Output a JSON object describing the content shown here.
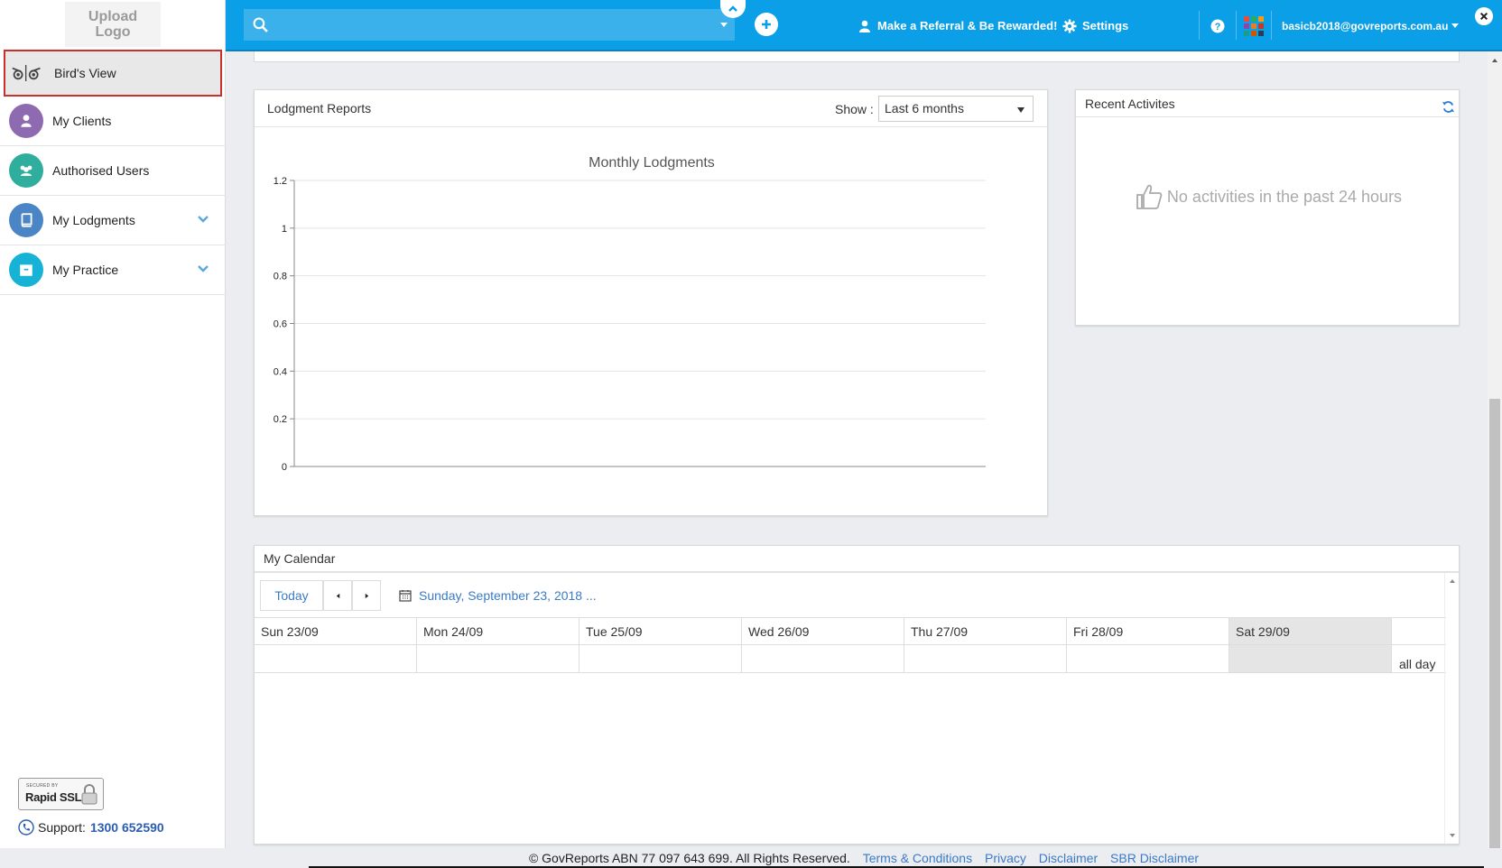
{
  "sidebar": {
    "logo_text": "Upload\nLogo",
    "items": [
      {
        "label": "Bird's View",
        "icon": "birds-view-icon",
        "color": "#555555"
      },
      {
        "label": "My Clients",
        "icon": "user-icon",
        "color": "#8e6bb0"
      },
      {
        "label": "Authorised Users",
        "icon": "users-icon",
        "color": "#2fae9e"
      },
      {
        "label": "My Lodgments",
        "icon": "book-icon",
        "color": "#4a86c5"
      },
      {
        "label": "My Practice",
        "icon": "briefcase-icon",
        "color": "#17b3d6"
      }
    ],
    "ssl_small": "SECURED BY",
    "ssl_big": "Rapid SSL",
    "support_label": "Support:",
    "support_number": "1300 652590"
  },
  "topbar": {
    "search_placeholder": "",
    "referral": "Make a Referral & Be Rewarded!",
    "settings": "Settings",
    "user_email": "basicb2018@govreports.com.au",
    "accent": "#0a9fe6"
  },
  "lodgment_reports": {
    "title": "Lodgment Reports",
    "show_label": "Show :",
    "show_value": "Last 6 months"
  },
  "chart_data": {
    "type": "line",
    "title": "Monthly Lodgments",
    "xlabel": "",
    "ylabel": "",
    "ylim": [
      0,
      1.2
    ],
    "yticks": [
      "1.2",
      "1",
      "0.8",
      "0.6",
      "0.4",
      "0.2",
      "0"
    ],
    "series": []
  },
  "recent": {
    "title": "Recent Activites",
    "empty": "No activities in the past 24 hours"
  },
  "calendar": {
    "title": "My Calendar",
    "today": "Today",
    "date_label": "Sunday, September 23, 2018 ...",
    "days": [
      "Sun 23/09",
      "Mon 24/09",
      "Tue 25/09",
      "Wed 26/09",
      "Thu 27/09",
      "Fri 28/09",
      "Sat 29/09"
    ],
    "all_day": "all day"
  },
  "footer": {
    "copyright": "© GovReports ABN 77 097 643 699. All Rights Reserved.",
    "links": [
      "Terms & Conditions",
      "Privacy",
      "Disclaimer",
      "SBR Disclaimer"
    ]
  }
}
